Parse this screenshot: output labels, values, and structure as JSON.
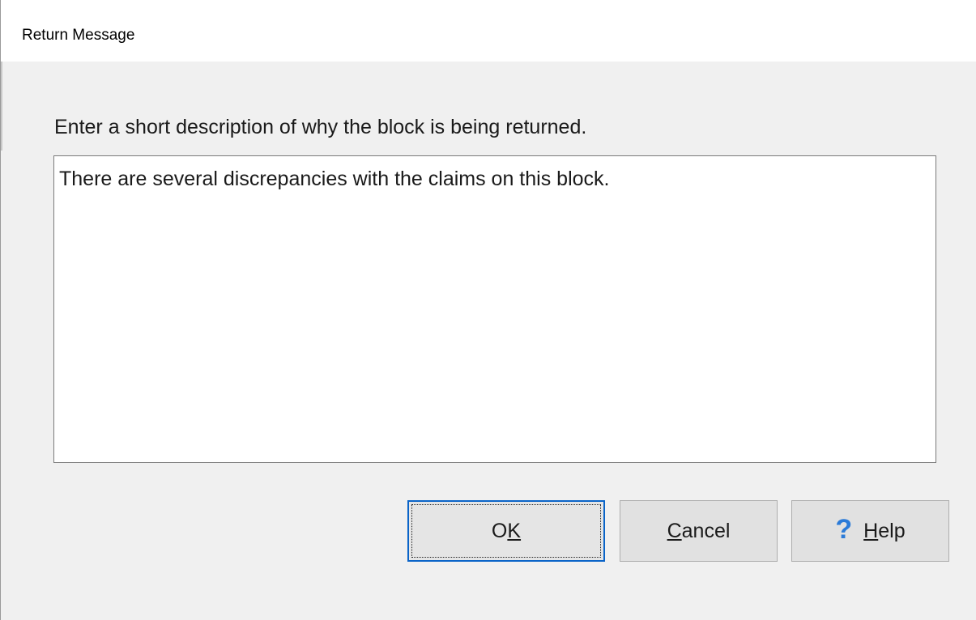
{
  "window": {
    "title": "Return Message"
  },
  "dialog": {
    "prompt": "Enter a short description of why the block is being returned.",
    "message_value": "There are several discrepancies with the claims on this block.",
    "buttons": {
      "ok": {
        "pre": "O",
        "accel": "K",
        "post": ""
      },
      "cancel": {
        "pre": "",
        "accel": "C",
        "post": "ancel"
      },
      "help": {
        "icon": "help-question-icon",
        "pre": "",
        "accel": "H",
        "post": "elp"
      }
    }
  },
  "colors": {
    "dialog_bg": "#f0f0f0",
    "focus_border": "#0a64c8",
    "help_icon": "#2b7bd8"
  }
}
